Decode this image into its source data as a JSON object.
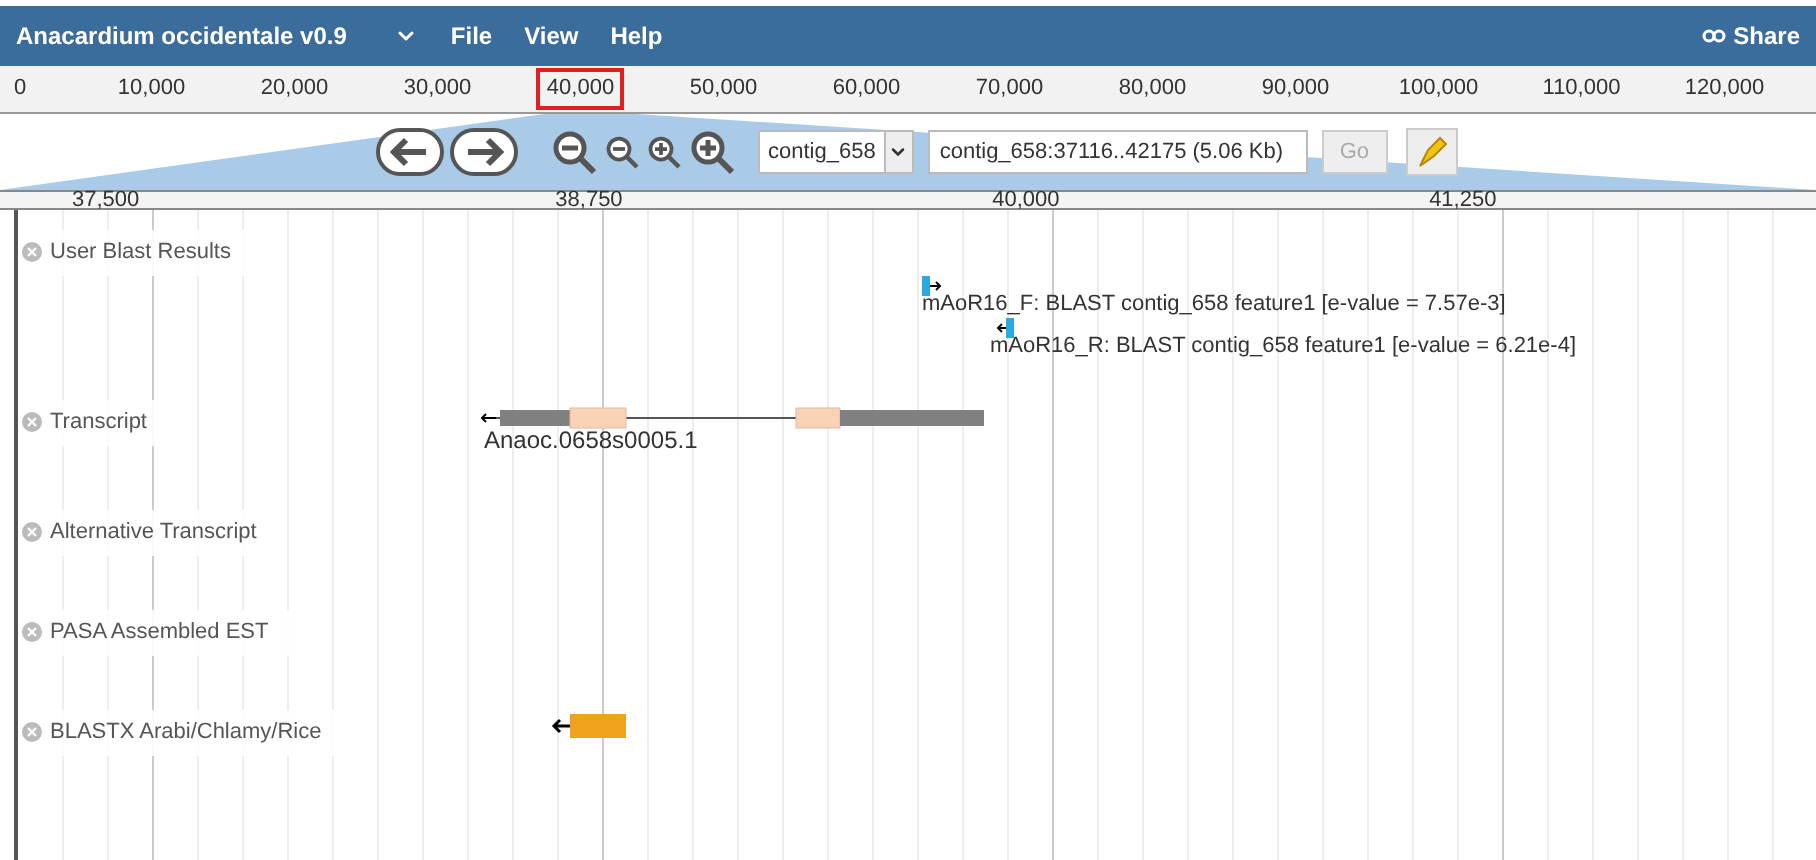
{
  "window": {
    "title": "Anacardium occidentale v0.9"
  },
  "menu": [
    "File",
    "View",
    "Help"
  ],
  "share": {
    "label": "Share"
  },
  "overview_ruler": [
    {
      "label": "0",
      "highlighted": false
    },
    {
      "label": "10,000",
      "highlighted": false
    },
    {
      "label": "20,000",
      "highlighted": false
    },
    {
      "label": "30,000",
      "highlighted": false
    },
    {
      "label": "40,000",
      "highlighted": true
    },
    {
      "label": "50,000",
      "highlighted": false
    },
    {
      "label": "60,000",
      "highlighted": false
    },
    {
      "label": "70,000",
      "highlighted": false
    },
    {
      "label": "80,000",
      "highlighted": false
    },
    {
      "label": "90,000",
      "highlighted": false
    },
    {
      "label": "100,000",
      "highlighted": false
    },
    {
      "label": "110,000",
      "highlighted": false
    },
    {
      "label": "120,000",
      "highlighted": false
    }
  ],
  "navigation": {
    "reference": "contig_658",
    "location": "contig_658:37116..42175 (5.06 Kb)",
    "go": {
      "label": "Go",
      "disabled": true
    }
  },
  "detail_ruler": [
    "37,500",
    "38,750",
    "40,000",
    "41,250"
  ],
  "tracks": [
    {
      "label": "User Blast Results",
      "features": [
        {
          "kind": "hit",
          "reverse_strand": false,
          "label": "mAoR16_F: BLAST contig_658 feature1 [e-value = 7.57e-3]"
        },
        {
          "kind": "hit",
          "reverse_strand": true,
          "label": "mAoR16_R: BLAST contig_658 feature1 [e-value = 6.21e-4]"
        }
      ]
    },
    {
      "label": "Transcript",
      "features": [
        {
          "kind": "gene",
          "reverse_strand": true,
          "label": "Anaoc.0658s0005.1"
        }
      ]
    },
    {
      "label": "Alternative Transcript"
    },
    {
      "label": "PASA Assembled EST"
    },
    {
      "label": "BLASTX Arabi/Chlamy/Rice",
      "features": [
        {
          "kind": "match",
          "reverse_strand": true
        }
      ]
    }
  ]
}
